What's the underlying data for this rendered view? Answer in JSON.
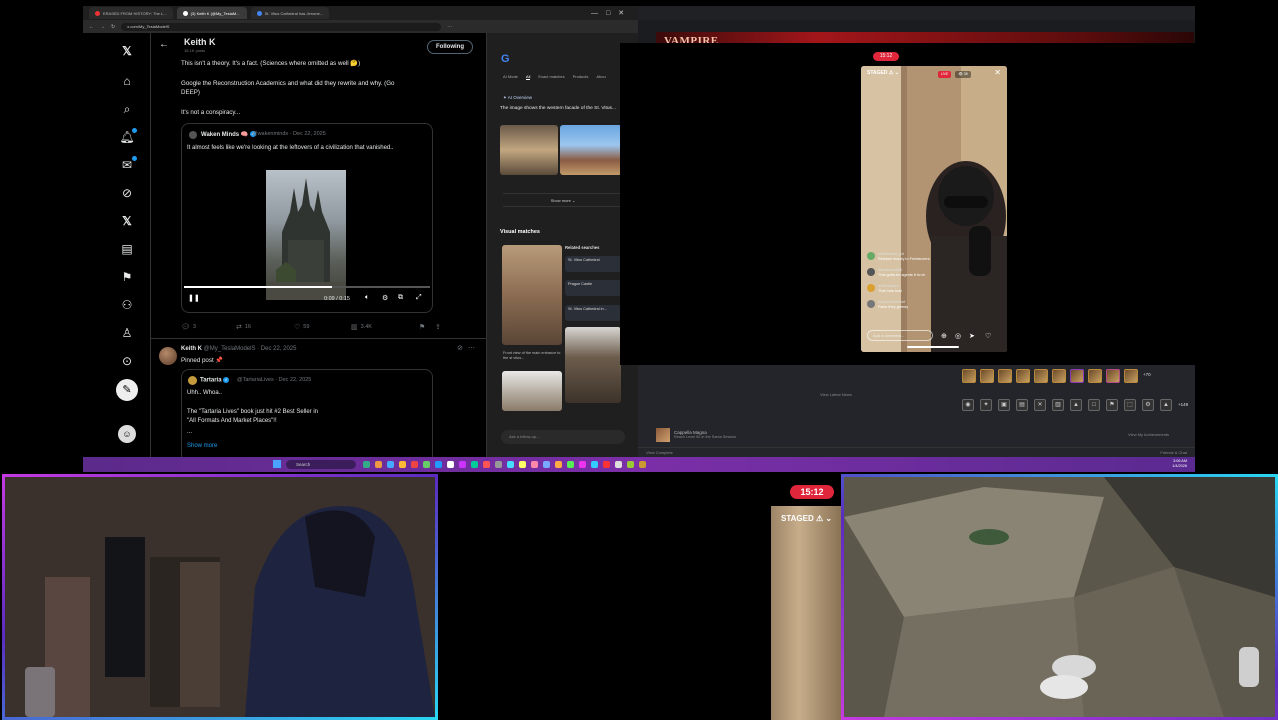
{
  "browser": {
    "tabs": [
      "ERASED FROM HISTORY: The L...",
      "(3) Keith K (@My_TeslaM...",
      "St. Vitus Cathedral has Jerome..."
    ],
    "url": "x.com/My_TeslaModelS",
    "win_controls": [
      "—",
      "□",
      "✕"
    ]
  },
  "x": {
    "nav_icons": [
      "x-logo-icon",
      "home-icon",
      "search-icon",
      "bell-icon",
      "mail-icon",
      "grok-slash-icon",
      "x-premium-icon",
      "list-icon",
      "bookmark-icon",
      "communities-icon",
      "profile-icon",
      "more-icon"
    ],
    "header": {
      "name": "Keith K",
      "posts": "18.1K posts",
      "follow_label": "Following"
    },
    "post1": {
      "line1": "This isn't a theory.  It's a fact.  (Sciences where omitted as well 🤔)",
      "line2": "Google the Reconstruction Academics and what did they rewrite and why. (Go",
      "line3": "DEEP)",
      "line4": "It's not a conspiracy...",
      "quote": {
        "name": "Waken Minds 🧠",
        "handle": "@wakenminds · Dec 22, 2025",
        "text": "It almost feels like we're looking at the leftovers of a civilization that vanished.."
      },
      "video": {
        "time": "0:09 / 0:15",
        "progress": 0.6
      },
      "actions": {
        "replies": "3",
        "reposts": "16",
        "likes": "59",
        "views": "3.4K"
      }
    },
    "post2": {
      "name": "Keith K",
      "handle": "@My_TeslaModelS · Dec 22, 2025",
      "text": "Pinned post 📌",
      "quote": {
        "name": "Tartaria",
        "handle": "@TartariaLives · Dec 22, 2025",
        "line1": "Uhh.. Whoa..",
        "line2": "The \"Tartaria Lives\" book just hit #2 Best Seller in",
        "line3": "\"All Formats And Market Places\"!!",
        "line4": "...",
        "show_more": "Show more"
      }
    }
  },
  "lens": {
    "tabs": [
      "AI Mode",
      "All",
      "Exact matches",
      "Products",
      "Abou"
    ],
    "ai_overview": "✦ AI Overview",
    "description": "The image shows the western facade of the St. Vitus...",
    "show_more": "Show more ⌄",
    "visual_matches": "Visual matches",
    "related_searches": "Related searches",
    "related": [
      "St. Vitus Cathedral",
      "Prague Castle",
      "St. Vitus Cathedral in..."
    ],
    "match_caption": "Front view of the main entrance to the st vitus...",
    "followup": "Ask a follow-up..."
  },
  "game": {
    "title": "VAMPIRE",
    "achievement_count_1": "+70",
    "achievement_count_2": "+149",
    "news": "View Latest News",
    "caption": "Cappella Magna",
    "caption_sub": "Reach Level 50 in the Santa Session",
    "view_all": "View My Achievements",
    "friends": "Friends & Chat",
    "complete": "View Complete"
  },
  "phone": {
    "clock": "15:12",
    "staged": "STAGED ⚠ ⌄",
    "live": "LIVE",
    "viewers": "👁 35",
    "comments": [
      {
        "user": "sherbertvai_gid",
        "text": "Release money to Freelancers"
      },
      {
        "user": "brimaboss888",
        "text": "That gotta be agents fr bruh"
      },
      {
        "user": "ambfrenlyeh",
        "text": "That hula tudz"
      },
      {
        "user": "theyboiGhddavit",
        "text": "Facts they greedy"
      }
    ],
    "input_placeholder": "Add a comment..."
  },
  "taskbar": {
    "search": "Search",
    "clock_time": "3:06 AM",
    "clock_date": "1/4/2026"
  },
  "overlay": {
    "clock": "15:12",
    "staged": "STAGED ⚠ ⌄"
  }
}
